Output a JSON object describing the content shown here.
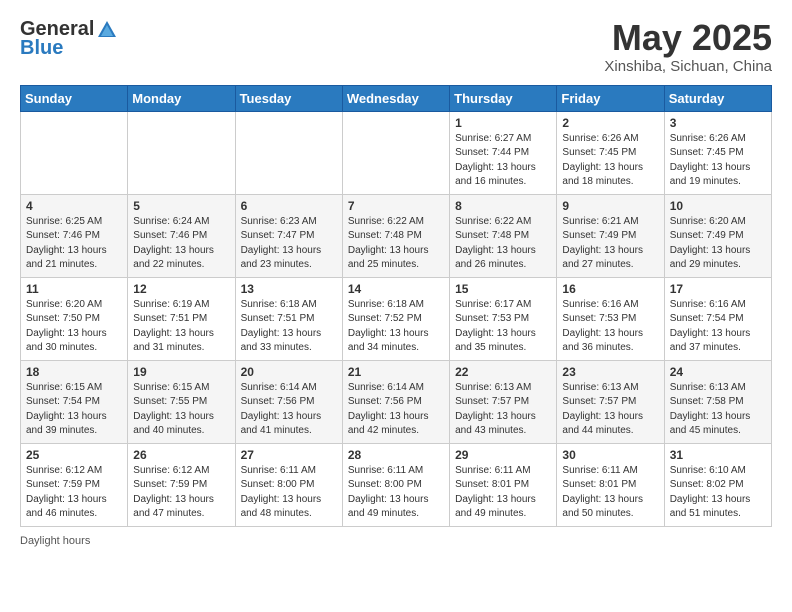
{
  "header": {
    "logo_general": "General",
    "logo_blue": "Blue",
    "month_title": "May 2025",
    "location": "Xinshiba, Sichuan, China"
  },
  "footer": {
    "daylight_label": "Daylight hours"
  },
  "weekdays": [
    "Sunday",
    "Monday",
    "Tuesday",
    "Wednesday",
    "Thursday",
    "Friday",
    "Saturday"
  ],
  "weeks": [
    [
      {
        "day": "",
        "info": ""
      },
      {
        "day": "",
        "info": ""
      },
      {
        "day": "",
        "info": ""
      },
      {
        "day": "",
        "info": ""
      },
      {
        "day": "1",
        "info": "Sunrise: 6:27 AM\nSunset: 7:44 PM\nDaylight: 13 hours\nand 16 minutes."
      },
      {
        "day": "2",
        "info": "Sunrise: 6:26 AM\nSunset: 7:45 PM\nDaylight: 13 hours\nand 18 minutes."
      },
      {
        "day": "3",
        "info": "Sunrise: 6:26 AM\nSunset: 7:45 PM\nDaylight: 13 hours\nand 19 minutes."
      }
    ],
    [
      {
        "day": "4",
        "info": "Sunrise: 6:25 AM\nSunset: 7:46 PM\nDaylight: 13 hours\nand 21 minutes."
      },
      {
        "day": "5",
        "info": "Sunrise: 6:24 AM\nSunset: 7:46 PM\nDaylight: 13 hours\nand 22 minutes."
      },
      {
        "day": "6",
        "info": "Sunrise: 6:23 AM\nSunset: 7:47 PM\nDaylight: 13 hours\nand 23 minutes."
      },
      {
        "day": "7",
        "info": "Sunrise: 6:22 AM\nSunset: 7:48 PM\nDaylight: 13 hours\nand 25 minutes."
      },
      {
        "day": "8",
        "info": "Sunrise: 6:22 AM\nSunset: 7:48 PM\nDaylight: 13 hours\nand 26 minutes."
      },
      {
        "day": "9",
        "info": "Sunrise: 6:21 AM\nSunset: 7:49 PM\nDaylight: 13 hours\nand 27 minutes."
      },
      {
        "day": "10",
        "info": "Sunrise: 6:20 AM\nSunset: 7:49 PM\nDaylight: 13 hours\nand 29 minutes."
      }
    ],
    [
      {
        "day": "11",
        "info": "Sunrise: 6:20 AM\nSunset: 7:50 PM\nDaylight: 13 hours\nand 30 minutes."
      },
      {
        "day": "12",
        "info": "Sunrise: 6:19 AM\nSunset: 7:51 PM\nDaylight: 13 hours\nand 31 minutes."
      },
      {
        "day": "13",
        "info": "Sunrise: 6:18 AM\nSunset: 7:51 PM\nDaylight: 13 hours\nand 33 minutes."
      },
      {
        "day": "14",
        "info": "Sunrise: 6:18 AM\nSunset: 7:52 PM\nDaylight: 13 hours\nand 34 minutes."
      },
      {
        "day": "15",
        "info": "Sunrise: 6:17 AM\nSunset: 7:53 PM\nDaylight: 13 hours\nand 35 minutes."
      },
      {
        "day": "16",
        "info": "Sunrise: 6:16 AM\nSunset: 7:53 PM\nDaylight: 13 hours\nand 36 minutes."
      },
      {
        "day": "17",
        "info": "Sunrise: 6:16 AM\nSunset: 7:54 PM\nDaylight: 13 hours\nand 37 minutes."
      }
    ],
    [
      {
        "day": "18",
        "info": "Sunrise: 6:15 AM\nSunset: 7:54 PM\nDaylight: 13 hours\nand 39 minutes."
      },
      {
        "day": "19",
        "info": "Sunrise: 6:15 AM\nSunset: 7:55 PM\nDaylight: 13 hours\nand 40 minutes."
      },
      {
        "day": "20",
        "info": "Sunrise: 6:14 AM\nSunset: 7:56 PM\nDaylight: 13 hours\nand 41 minutes."
      },
      {
        "day": "21",
        "info": "Sunrise: 6:14 AM\nSunset: 7:56 PM\nDaylight: 13 hours\nand 42 minutes."
      },
      {
        "day": "22",
        "info": "Sunrise: 6:13 AM\nSunset: 7:57 PM\nDaylight: 13 hours\nand 43 minutes."
      },
      {
        "day": "23",
        "info": "Sunrise: 6:13 AM\nSunset: 7:57 PM\nDaylight: 13 hours\nand 44 minutes."
      },
      {
        "day": "24",
        "info": "Sunrise: 6:13 AM\nSunset: 7:58 PM\nDaylight: 13 hours\nand 45 minutes."
      }
    ],
    [
      {
        "day": "25",
        "info": "Sunrise: 6:12 AM\nSunset: 7:59 PM\nDaylight: 13 hours\nand 46 minutes."
      },
      {
        "day": "26",
        "info": "Sunrise: 6:12 AM\nSunset: 7:59 PM\nDaylight: 13 hours\nand 47 minutes."
      },
      {
        "day": "27",
        "info": "Sunrise: 6:11 AM\nSunset: 8:00 PM\nDaylight: 13 hours\nand 48 minutes."
      },
      {
        "day": "28",
        "info": "Sunrise: 6:11 AM\nSunset: 8:00 PM\nDaylight: 13 hours\nand 49 minutes."
      },
      {
        "day": "29",
        "info": "Sunrise: 6:11 AM\nSunset: 8:01 PM\nDaylight: 13 hours\nand 49 minutes."
      },
      {
        "day": "30",
        "info": "Sunrise: 6:11 AM\nSunset: 8:01 PM\nDaylight: 13 hours\nand 50 minutes."
      },
      {
        "day": "31",
        "info": "Sunrise: 6:10 AM\nSunset: 8:02 PM\nDaylight: 13 hours\nand 51 minutes."
      }
    ]
  ]
}
